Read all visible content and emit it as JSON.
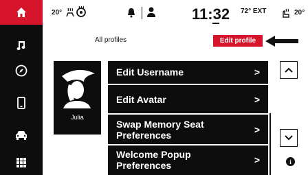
{
  "status": {
    "left_temp": "20°",
    "clock": "11:32",
    "ext_temp": "72° EXT",
    "right_temp": "20°"
  },
  "header": {
    "all_profiles": "All profiles",
    "edit_profile": "Edit profile"
  },
  "profile": {
    "name": "Julia"
  },
  "menu": {
    "items": [
      {
        "label": "Edit Username",
        "chevron": ">"
      },
      {
        "label": "Edit Avatar",
        "chevron": ">"
      },
      {
        "label_line1": "Swap Memory Seat",
        "label_line2": "Preferences",
        "chevron": ">"
      },
      {
        "label_line1": "Welcome Popup",
        "label_line2": "Preferences",
        "chevron": ">"
      }
    ]
  },
  "icons": {
    "sidebar": [
      "home-icon",
      "music-icon",
      "compass-icon",
      "phone-icon",
      "car-icon",
      "apps-grid-icon"
    ],
    "status": [
      "heated-steering-icon",
      "heated-seat-icon",
      "notification-bell-icon",
      "user-profile-icon",
      "heated-seat-icon"
    ],
    "info": "i"
  },
  "colors": {
    "accent": "#d6142c",
    "panel": "#0d0d0d"
  }
}
